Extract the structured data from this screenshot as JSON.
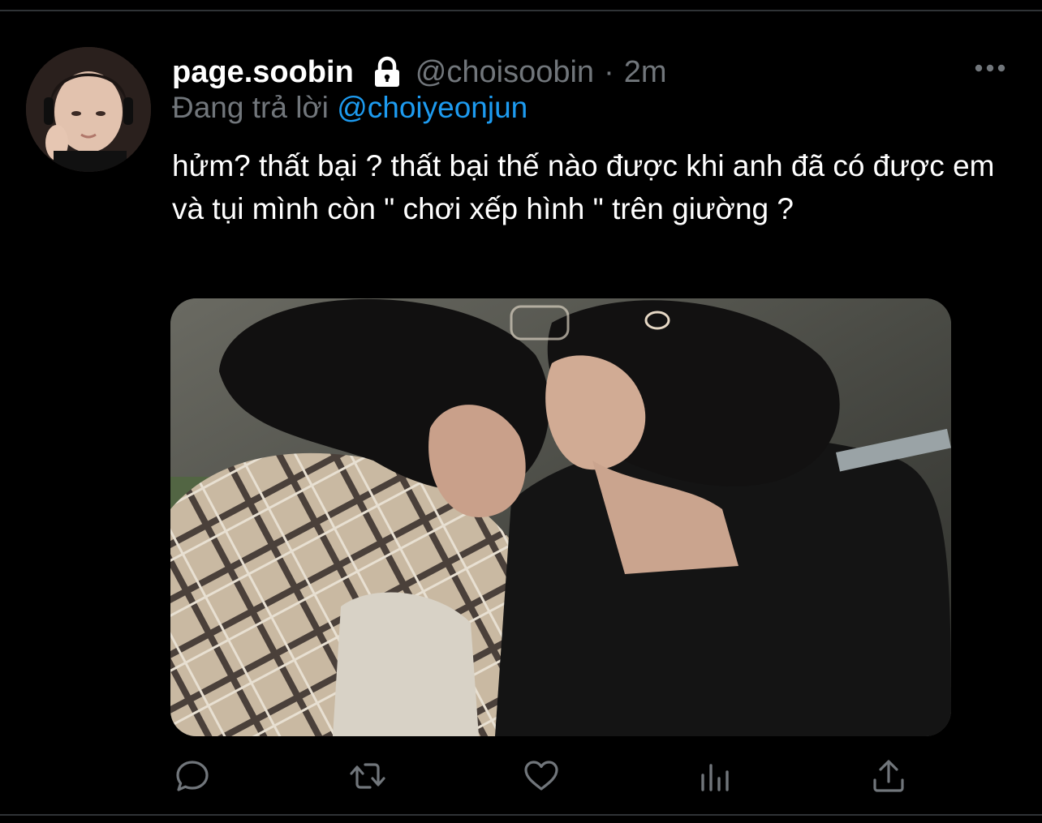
{
  "tweet": {
    "display_name": "page.soobin",
    "handle": "@choisoobin",
    "separator": "·",
    "time": "2m",
    "reply_prefix": "Đang trả lời",
    "reply_to": "@choiyeonjun",
    "text": "hửm? thất bại ? thất bại thế nào được khi anh đã có được em và tụi mình còn \" chơi xếp hình \" trên giường ?"
  },
  "icons": {
    "lock": "lock-icon",
    "more": "more-options-icon",
    "reply": "reply-icon",
    "retweet": "retweet-icon",
    "like": "heart-icon",
    "analytics": "analytics-icon",
    "share": "share-icon"
  },
  "colors": {
    "background": "#000000",
    "primary_text": "#ffffff",
    "secondary_text": "#71767b",
    "accent": "#1d9bf0",
    "divider": "#2f3336"
  }
}
